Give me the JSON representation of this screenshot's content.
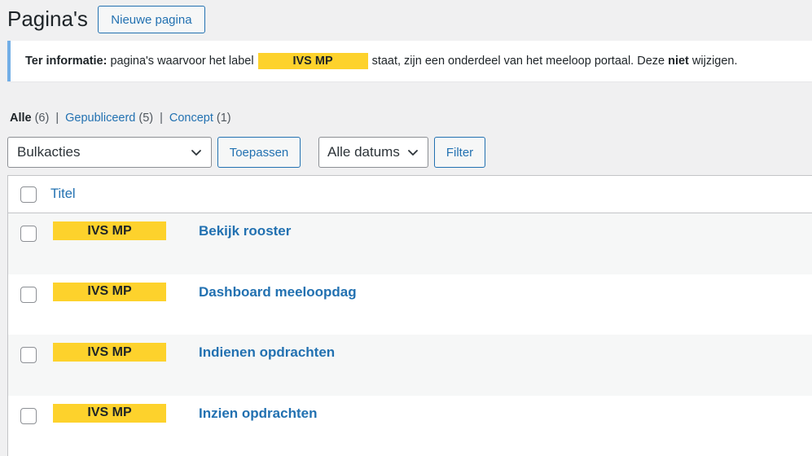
{
  "header": {
    "title": "Pagina's",
    "new_page_label": "Nieuwe pagina"
  },
  "notice": {
    "prefix_bold": "Ter informatie:",
    "text_before": "pagina's waarvoor het label",
    "label": "IVS MP",
    "text_after": "staat, zijn een onderdeel van het meeloop portaal. Deze",
    "emphasis": "niet",
    "text_end": "wijzigen."
  },
  "views": {
    "all_label": "Alle",
    "all_count": "(6)",
    "published_label": "Gepubliceerd",
    "published_count": "(5)",
    "draft_label": "Concept",
    "draft_count": "(1)",
    "separator": "|"
  },
  "tablenav": {
    "bulk_actions": "Bulkacties",
    "apply_label": "Toepassen",
    "dates": "Alle datums",
    "filter_label": "Filter"
  },
  "table": {
    "title_column": "Titel",
    "rows": [
      {
        "label": "IVS MP",
        "title": "Bekijk rooster"
      },
      {
        "label": "IVS MP",
        "title": "Dashboard meeloopdag"
      },
      {
        "label": "IVS MP",
        "title": "Indienen opdrachten"
      },
      {
        "label": "IVS MP",
        "title": "Inzien opdrachten"
      }
    ]
  },
  "colors": {
    "accent": "#2271b1",
    "label_bg": "#fdd22c",
    "notice_border": "#72aee6",
    "background": "#f0f0f1"
  }
}
